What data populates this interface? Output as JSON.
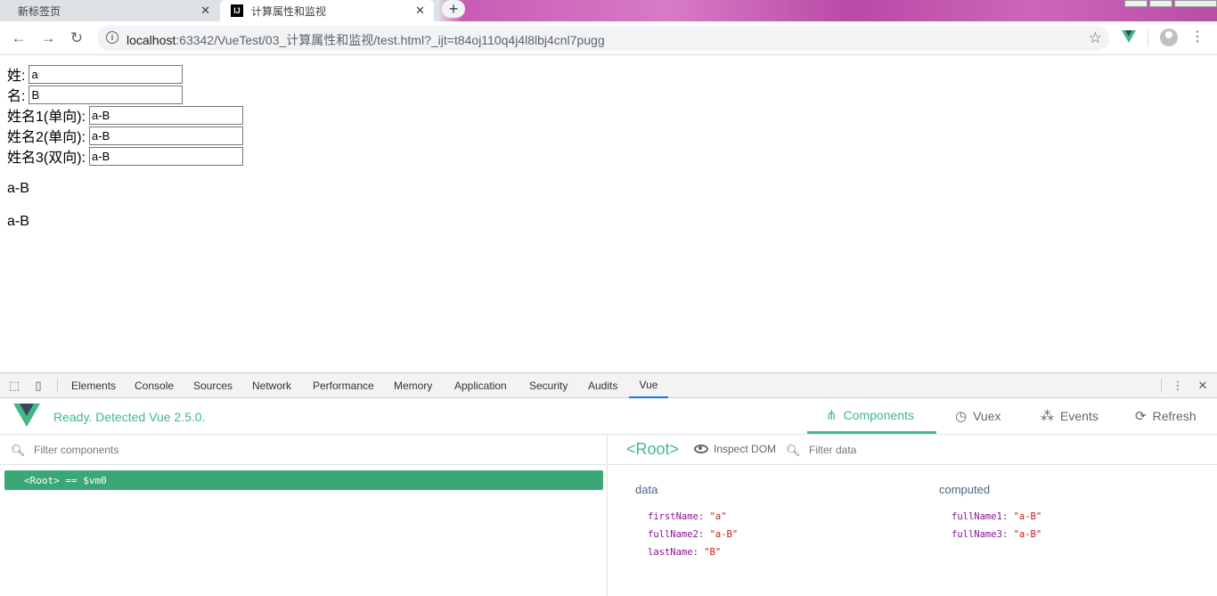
{
  "browser": {
    "tabs": [
      {
        "title": "新标签页",
        "active": false
      },
      {
        "title": "计算属性和监视",
        "active": true,
        "favicon": "IJ"
      }
    ],
    "new_tab_symbol": "+",
    "close_symbol": "✕",
    "url_host": "localhost",
    "url_rest": ":63342/VueTest/03_计算属性和监视/test.html?_ijt=t84oj110q4j4l8lbj4cnl7pugg"
  },
  "page": {
    "fields": [
      {
        "label": "姓:",
        "value": "a"
      },
      {
        "label": "名:",
        "value": "B"
      },
      {
        "label": "姓名1(单向):",
        "value": "a-B"
      },
      {
        "label": "姓名2(单向):",
        "value": "a-B"
      },
      {
        "label": "姓名3(双向):",
        "value": "a-B"
      }
    ],
    "outputs": [
      "a-B",
      "a-B"
    ]
  },
  "devtools": {
    "tabs": [
      "Elements",
      "Console",
      "Sources",
      "Network",
      "Performance",
      "Memory",
      "Application",
      "Security",
      "Audits",
      "Vue"
    ],
    "active_tab": "Vue"
  },
  "vue": {
    "status": "Ready. Detected Vue 2.5.0.",
    "nav": [
      {
        "label": "Components",
        "icon": "components-icon",
        "active": true
      },
      {
        "label": "Vuex",
        "icon": "history-icon",
        "active": false
      },
      {
        "label": "Events",
        "icon": "events-icon",
        "active": false
      },
      {
        "label": "Refresh",
        "icon": "refresh-icon",
        "active": false
      }
    ],
    "filter_components_placeholder": "Filter components",
    "root_row": "<Root> == $vm0",
    "selected_component": "<Root>",
    "inspect_dom": "Inspect DOM",
    "filter_data_placeholder": "Filter data",
    "data_title": "data",
    "computed_title": "computed",
    "data": [
      {
        "key": "firstName",
        "value": "\"a\""
      },
      {
        "key": "fullName2",
        "value": "\"a-B\""
      },
      {
        "key": "lastName",
        "value": "\"B\""
      }
    ],
    "computed": [
      {
        "key": "fullName1",
        "value": "\"a-B\""
      },
      {
        "key": "fullName3",
        "value": "\"a-B\""
      }
    ],
    "accent_color": "#42b983"
  }
}
